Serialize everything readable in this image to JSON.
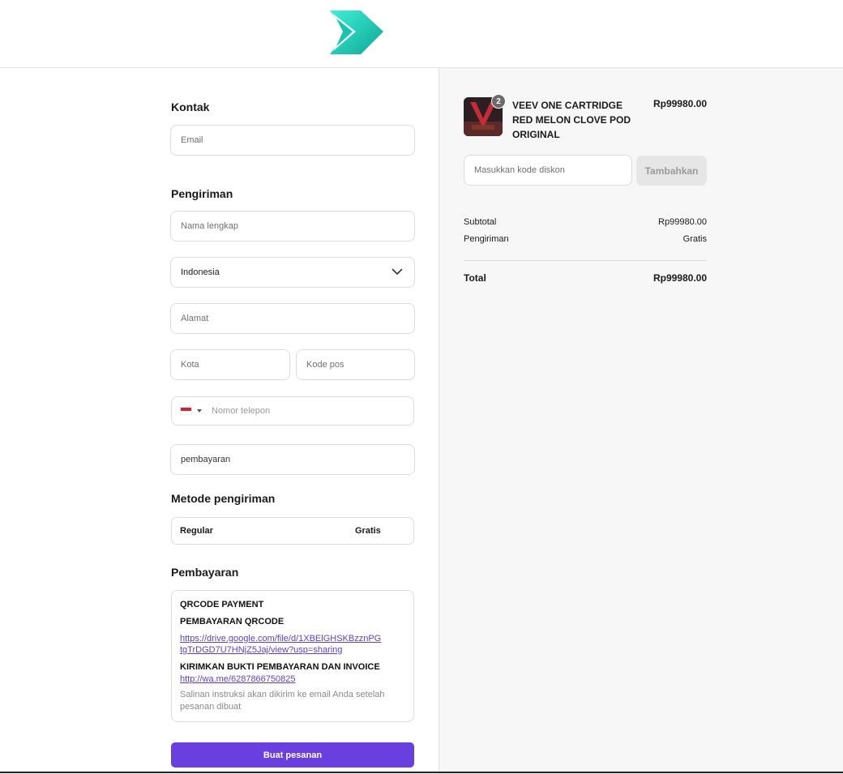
{
  "contact": {
    "title": "Kontak",
    "email_placeholder": "Email"
  },
  "shipping": {
    "title": "Pengiriman",
    "full_name_placeholder": "Nama lengkap",
    "country_value": "Indonesia",
    "address_placeholder": "Alamat",
    "city_placeholder": "Kota",
    "postal_placeholder": "Kode pos",
    "phone_placeholder": "Nomor telepon",
    "payment_field_value": "pembayaran"
  },
  "shipping_method": {
    "title": "Metode pengiriman",
    "name": "Regular",
    "price": "Gratis"
  },
  "payment": {
    "title": "Pembayaran",
    "line1": "QRCODE PAYMENT",
    "line2": "PEMBAYARAN QRCODE",
    "link1": "https://drive.google.com/file/d/1XBElGHSKBzznPGtgTrDGD7U7HNjZ5Jaj/view?usp=sharing",
    "line3": "KIRIMKAN BUKTI PEMBAYARAN DAN INVOICE",
    "link2": "http://wa.me/6287866750825",
    "note": "Salinan instruksi akan dikirim ke email Anda setelah pesanan dibuat"
  },
  "submit_label": "Buat pesanan",
  "cart": {
    "quantity": "2",
    "product_name": "VEEV ONE CARTRIDGE RED MELON CLOVE POD ORIGINAL",
    "product_price": "Rp99980.00",
    "discount_placeholder": "Masukkan kode diskon",
    "apply_label": "Tambahkan",
    "subtotal_label": "Subtotal",
    "subtotal_value": "Rp99980.00",
    "shipping_label": "Pengiriman",
    "shipping_value": "Gratis",
    "total_label": "Total",
    "total_value": "Rp99980.00"
  },
  "colors": {
    "accent": "#6a3fe0",
    "logo_gradient_start": "#2ee6c8",
    "logo_gradient_end": "#0d9b8c"
  },
  "icons": {
    "logo": "play-arrow-logo",
    "country_dropdown": "chevron-down-icon",
    "phone_flag": "indonesia-flag-icon"
  }
}
